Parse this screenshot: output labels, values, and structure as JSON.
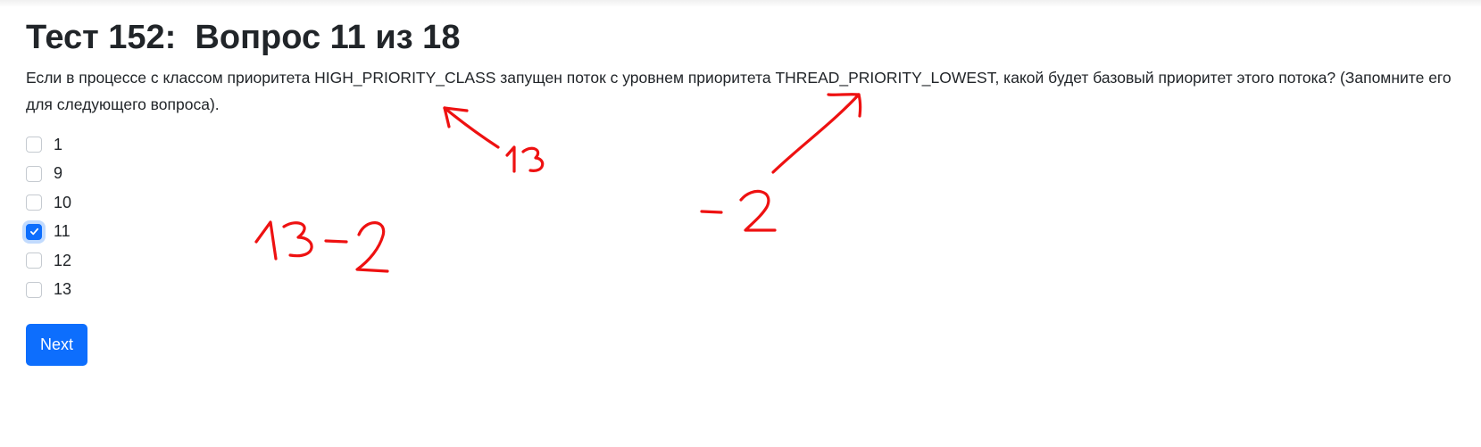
{
  "header": {
    "title": "Тест 152:  Вопрос 11 из 18"
  },
  "question": {
    "text": "Если в процессе с классом приоритета HIGH_PRIORITY_CLASS запущен поток с уровнем приоритета THREAD_PRIORITY_LOWEST, какой будет базовый приоритет этого потока? (Запомните его для следующего вопроса)."
  },
  "options": [
    {
      "label": "1",
      "checked": false
    },
    {
      "label": "9",
      "checked": false
    },
    {
      "label": "10",
      "checked": false
    },
    {
      "label": "11",
      "checked": true
    },
    {
      "label": "12",
      "checked": false
    },
    {
      "label": "13",
      "checked": false
    }
  ],
  "actions": {
    "next_label": "Next"
  },
  "annotations": {
    "note_class": "13",
    "note_thread": "-2",
    "note_formula": "13-2",
    "ink_color": "#ee1111"
  },
  "colors": {
    "accent": "#0d6efd",
    "text": "#212529"
  }
}
